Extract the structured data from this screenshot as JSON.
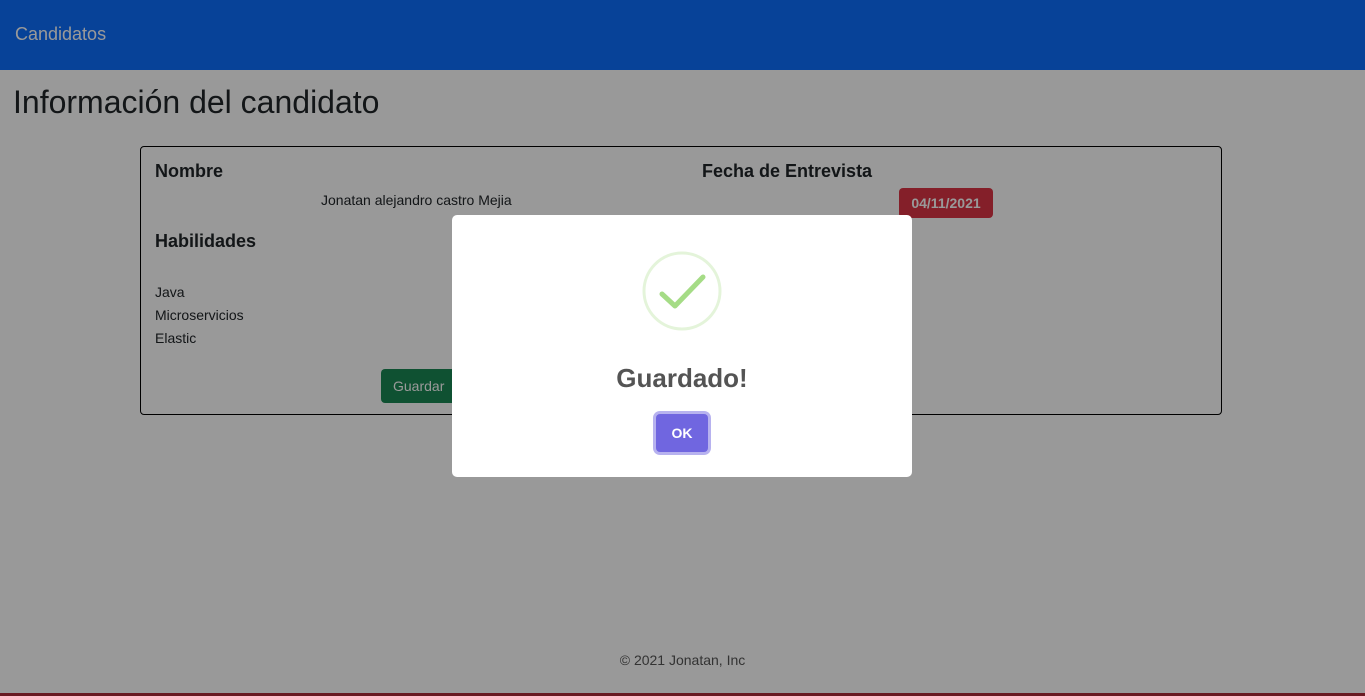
{
  "navbar": {
    "brand": "Candidatos",
    "color": "#0d6efd"
  },
  "page": {
    "title": "Información del candidato"
  },
  "candidate": {
    "name_label": "Nombre",
    "name_value": "Jonatan alejandro castro Mejia",
    "interview_label": "Fecha de Entrevista",
    "interview_date": "04/11/2021",
    "skills_label": "Habilidades",
    "skills": [
      "Java",
      "Microservicios",
      "Elastic"
    ],
    "save_label": "Guardar"
  },
  "footer": {
    "text": "© 2021 Jonatan, Inc"
  },
  "modal": {
    "icon": "success-check-icon",
    "title": "Guardado!",
    "ok_label": "OK",
    "ok_color": "#7066e0",
    "icon_color": "#a5dc86"
  }
}
